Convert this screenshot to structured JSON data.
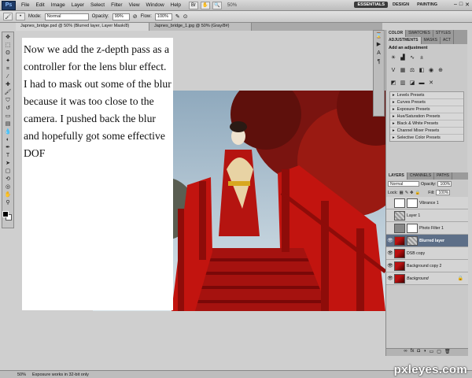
{
  "menubar": {
    "logo": "Ps",
    "items": [
      "File",
      "Edit",
      "Image",
      "Layer",
      "Select",
      "Filter",
      "View",
      "Window",
      "Help"
    ],
    "zoom": "50%",
    "workspaces": [
      "ESSENTIALS",
      "DESIGN",
      "PAINTING"
    ],
    "active_workspace": "ESSENTIALS"
  },
  "options": {
    "mode_label": "Mode:",
    "mode_value": "Normal",
    "opacity_label": "Opacity:",
    "opacity_value": "99%",
    "flow_label": "Flow:",
    "flow_value": "100%"
  },
  "doc_tabs": [
    {
      "label": "Japnes_bridge.psd @ 50% (Blurred layer, Layer Mask/8)",
      "active": true
    },
    {
      "label": "Japnes_bridge_1.jpg @ 50% (Gray/8#)",
      "active": false
    }
  ],
  "text_card": {
    "body": "Now we add the z-depth pass as a controller for the lens blur effect. I had to mask out some of the blur because it was too close to the camera. I pushed back the blur and hopefully got some effective DOF"
  },
  "panels": {
    "color_tabs": [
      "COLOR",
      "SWATCHES",
      "STYLES"
    ],
    "adj_tabs": [
      "ADJUSTMENTS",
      "MASKS",
      "ACT"
    ],
    "adj_heading": "Add an adjustment",
    "presets": [
      "Levels Presets",
      "Curves Presets",
      "Exposure Presets",
      "Hue/Saturation Presets",
      "Black & White Presets",
      "Channel Mixer Presets",
      "Selective Color Presets"
    ]
  },
  "layers": {
    "tabs": [
      "LAYERS",
      "CHANNELS",
      "PATHS"
    ],
    "blend": "Normal",
    "opacity_label": "Opacity:",
    "opacity_value": "100%",
    "lock_label": "Lock:",
    "fill_label": "Fill:",
    "fill_value": "100%",
    "rows": [
      {
        "name": "Vibrance 1",
        "thumb": "white",
        "visible": false,
        "selected": false
      },
      {
        "name": "Layer 1",
        "thumb": "check",
        "visible": false,
        "selected": false
      },
      {
        "name": "Photo Filter 1",
        "thumb": "white",
        "visible": false,
        "selected": false
      },
      {
        "name": "Blurred layer",
        "thumb": "red",
        "visible": true,
        "selected": true
      },
      {
        "name": "DSB copy",
        "thumb": "red",
        "visible": true,
        "selected": false
      },
      {
        "name": "Background copy 2",
        "thumb": "red",
        "visible": true,
        "selected": false
      },
      {
        "name": "Background",
        "thumb": "red",
        "visible": true,
        "selected": false
      }
    ]
  },
  "status": {
    "zoom": "50%",
    "info": "Exposure works in 32-bit only"
  },
  "watermark": "pxleyes.com"
}
